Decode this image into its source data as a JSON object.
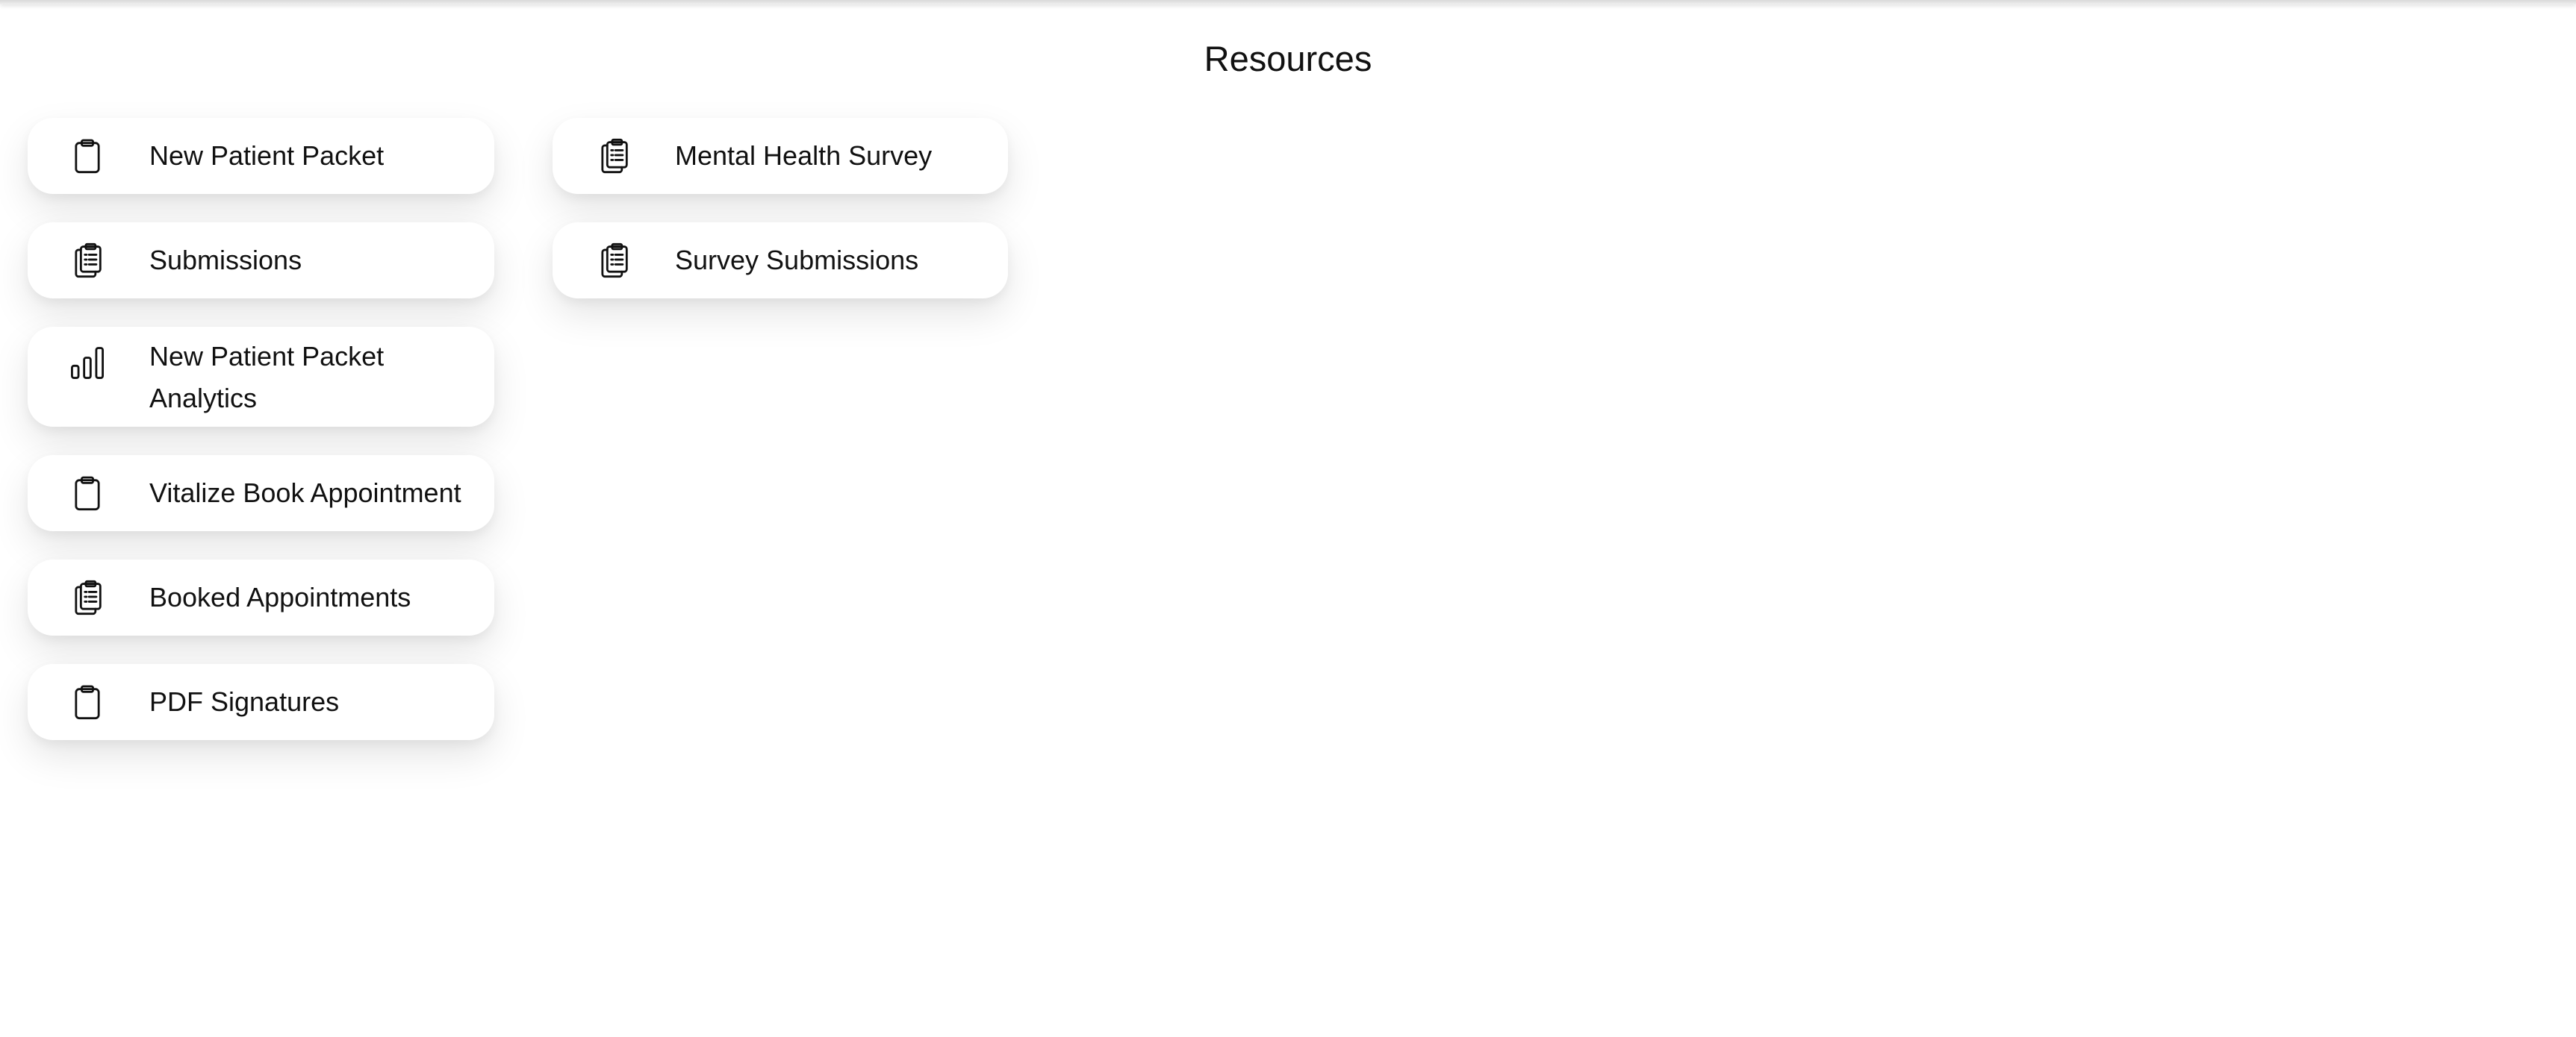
{
  "page": {
    "title": "Resources"
  },
  "resources": [
    {
      "label": "New Patient Packet",
      "icon": "clipboard-icon"
    },
    {
      "label": "Submissions",
      "icon": "clipboard-list-icon"
    },
    {
      "label": "New Patient Packet Analytics",
      "icon": "bar-chart-icon"
    },
    {
      "label": "Vitalize Book Appointment",
      "icon": "clipboard-icon"
    },
    {
      "label": "Booked Appointments",
      "icon": "clipboard-list-icon"
    },
    {
      "label": "PDF Signatures",
      "icon": "clipboard-icon"
    },
    {
      "label": "Mental Health Survey",
      "icon": "clipboard-list-icon"
    },
    {
      "label": "Survey Submissions",
      "icon": "clipboard-list-icon"
    }
  ]
}
